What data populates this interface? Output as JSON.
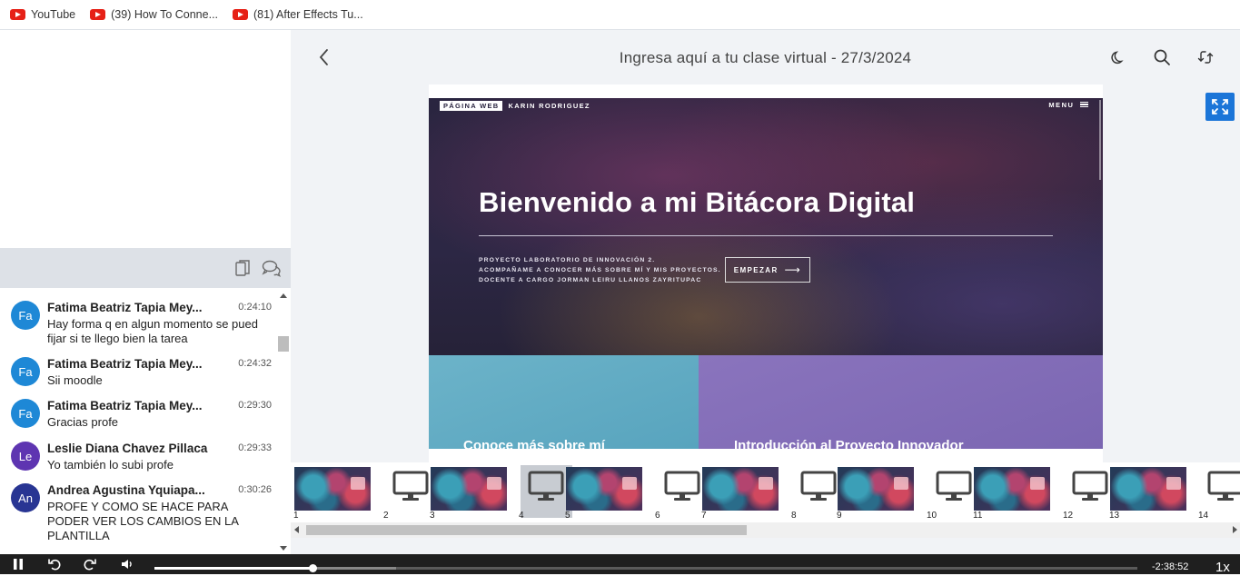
{
  "bookmarks": [
    {
      "label": "YouTube",
      "icon": "youtube-icon"
    },
    {
      "label": "(39) How To Conne...",
      "icon": "youtube-icon"
    },
    {
      "label": "(81) After Effects Tu...",
      "icon": "youtube-icon"
    }
  ],
  "session": {
    "title": "Ingresa aquí a tu clase virtual - 27/3/2024"
  },
  "chat": {
    "messages": [
      {
        "initials": "Fa",
        "avatar_color": "#1e88d6",
        "name": "Fatima Beatriz Tapia Mey...",
        "time": "0:24:10",
        "text": "Hay forma q en algun momento se pued fijar si te llego bien la tarea"
      },
      {
        "initials": "Fa",
        "avatar_color": "#1e88d6",
        "name": "Fatima Beatriz Tapia Mey...",
        "time": "0:24:32",
        "text": "Sii moodle"
      },
      {
        "initials": "Fa",
        "avatar_color": "#1e88d6",
        "name": "Fatima Beatriz Tapia Mey...",
        "time": "0:29:30",
        "text": "Gracias profe"
      },
      {
        "initials": "Le",
        "avatar_color": "#5e35b1",
        "name": "Leslie Diana Chavez Pillaca",
        "time": "0:29:33",
        "text": "Yo también lo subi profe"
      },
      {
        "initials": "An",
        "avatar_color": "#283593",
        "name": "Andrea Agustina Yquiapa...",
        "time": "0:30:26",
        "text": "PROFE Y COMO SE HACE PARA PODER VER LOS CAMBIOS EN LA PLANTILLA"
      }
    ]
  },
  "slide": {
    "site_tag": "PÁGINA WEB",
    "site_owner": "KARIN RODRIGUEZ",
    "menu_label": "MENU",
    "hero_title": "Bienvenido a mi Bitácora Digital",
    "hero_sub_1": "PROYECTO LABORATORIO DE INNOVACIÓN 2.",
    "hero_sub_2": "ACOMPAÑAME A CONOCER MÁS SOBRE MÍ Y MIS PROYECTOS.",
    "hero_sub_3": "DOCENTE A CARGO JORMAN LEIRU LLANOS ZAYRITUPAC",
    "start_label": "EMPEZAR",
    "panel_a_title": "Conoce más sobre mí",
    "panel_b_title": "Introducción al Proyecto Innovador"
  },
  "thumbnails": [
    {
      "num": "1",
      "kind": "photo"
    },
    {
      "num": "2",
      "kind": "screen"
    },
    {
      "num": "3",
      "kind": "photo"
    },
    {
      "num": "4",
      "kind": "screen",
      "active": true
    },
    {
      "num": "5",
      "kind": "photo"
    },
    {
      "num": "6",
      "kind": "screen"
    },
    {
      "num": "7",
      "kind": "photo"
    },
    {
      "num": "8",
      "kind": "screen"
    },
    {
      "num": "9",
      "kind": "photo"
    },
    {
      "num": "10",
      "kind": "screen"
    },
    {
      "num": "11",
      "kind": "photo"
    },
    {
      "num": "12",
      "kind": "screen"
    },
    {
      "num": "13",
      "kind": "photo"
    },
    {
      "num": "14",
      "kind": "screen"
    }
  ],
  "player": {
    "time_remaining": "-2:38:52",
    "speed": "1x",
    "progress_fraction": 0.161,
    "buffered_fraction": 0.246,
    "state": "playing"
  },
  "colors": {
    "accent": "#1b75d8",
    "player_bg": "#1f1f1f",
    "chat_toolbar_bg": "#dde1e7"
  }
}
